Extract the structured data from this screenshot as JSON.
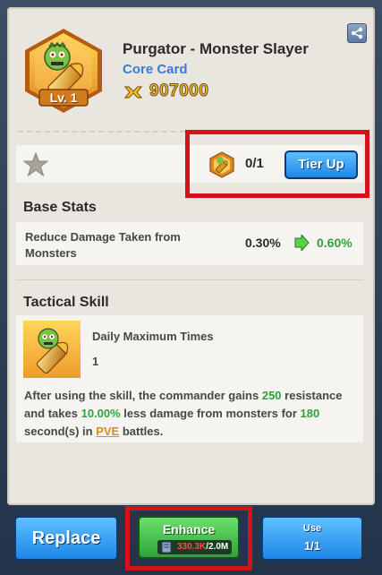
{
  "card": {
    "title": "Purgator - Monster Slayer",
    "subtitle": "Core Card",
    "level": "Lv. 1",
    "power": "907000"
  },
  "tier": {
    "count": "0/1",
    "button": "Tier Up"
  },
  "base_stats": {
    "title": "Base Stats",
    "name": "Reduce Damage Taken from Monsters",
    "old_value": "0.30%",
    "new_value": "0.60%"
  },
  "tactical": {
    "title": "Tactical Skill",
    "label": "Daily Maximum Times",
    "value": "1",
    "desc": {
      "p1": "After using the skill, the commander gains ",
      "v1": "250",
      "p2": " resistance and takes ",
      "v2": "10.00%",
      "p3": " less damage from monsters for ",
      "v3": "180",
      "p4": " second(s) in ",
      "v4": "PVE",
      "p5": " battles."
    }
  },
  "buttons": {
    "replace": "Replace",
    "enhance": "Enhance",
    "enhance_have": "330.3K",
    "enhance_need": "/2.0M",
    "use_label": "Use",
    "use_count": "1/1"
  },
  "colors": {
    "accent_blue": "#1e86e8",
    "accent_green": "#2fa23a",
    "highlight_red": "#d4121c",
    "gold": "#f6c728"
  }
}
